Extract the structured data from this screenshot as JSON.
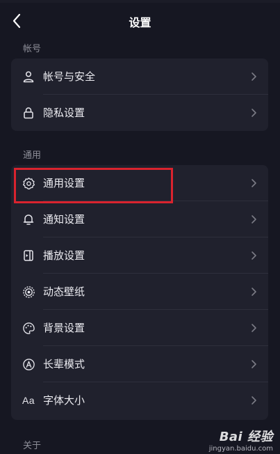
{
  "header": {
    "title": "设置"
  },
  "sections": {
    "account": {
      "title": "帐号",
      "items": [
        {
          "label": "帐号与安全",
          "icon": "user-icon"
        },
        {
          "label": "隐私设置",
          "icon": "lock-icon"
        }
      ]
    },
    "general": {
      "title": "通用",
      "items": [
        {
          "label": "通用设置",
          "icon": "gear-icon"
        },
        {
          "label": "通知设置",
          "icon": "bell-icon"
        },
        {
          "label": "播放设置",
          "icon": "play-settings-icon"
        },
        {
          "label": "动态壁纸",
          "icon": "dynamic-wallpaper-icon"
        },
        {
          "label": "背景设置",
          "icon": "palette-icon"
        },
        {
          "label": "长辈模式",
          "icon": "elder-mode-icon"
        },
        {
          "label": "字体大小",
          "icon": "font-size-icon",
          "icon_text": "Aa"
        }
      ]
    },
    "about": {
      "title": "关于"
    }
  },
  "watermark": {
    "line1": "Bai 经验",
    "line2": "jingyan.baidu.com"
  },
  "colors": {
    "background": "#161722",
    "card": "#20212d",
    "highlight": "#d9232e"
  }
}
